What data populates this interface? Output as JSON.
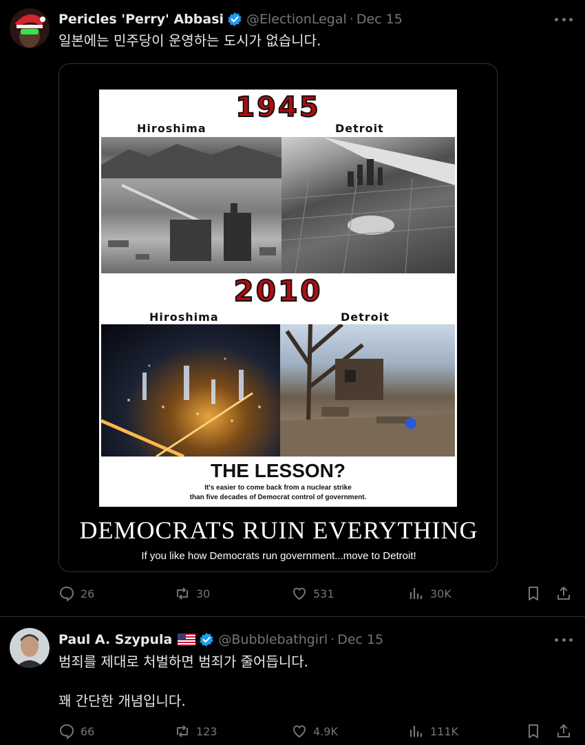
{
  "tweets": [
    {
      "author": "Pericles 'Perry' Abbasi",
      "handle": "@ElectionLegal",
      "separator": "·",
      "date": "Dec 15",
      "text": "일본에는 민주당이 운영하는 도시가 없습니다.",
      "media": {
        "year_top": "1945",
        "city_top_left": "Hiroshima",
        "city_top_right": "Detroit",
        "year_bottom": "2010",
        "city_bottom_left": "Hiroshima",
        "city_bottom_right": "Detroit",
        "lesson_title": "THE LESSON?",
        "lesson_line1": "It's easier to come back from a nuclear strike",
        "lesson_line2": "than five decades of Democrat control of government.",
        "headline": "DEMOCRATS RUIN EVERYTHING",
        "tagline": "If you like how Democrats run government...move to Detroit!"
      },
      "stats": {
        "replies": "26",
        "reposts": "30",
        "likes": "531",
        "views": "30K"
      }
    },
    {
      "author": "Paul A. Szypula",
      "handle": "@Bubblebathgirl",
      "separator": "·",
      "date": "Dec 15",
      "text_line1": "범죄를 제대로 처벌하면 범죄가 줄어듭니다.",
      "text_line2": "꽤 간단한 개념입니다.",
      "stats": {
        "replies": "66",
        "reposts": "123",
        "likes": "4.9K",
        "views": "111K"
      }
    }
  ],
  "colors": {
    "background": "#000000",
    "text": "#e7e9ea",
    "muted": "#71767b",
    "verified": "#1d9bf0",
    "divider": "#2f3336"
  },
  "icons": [
    "reply-icon",
    "repost-icon",
    "like-icon",
    "views-icon",
    "bookmark-icon",
    "share-icon",
    "verified-icon",
    "more-icon"
  ]
}
